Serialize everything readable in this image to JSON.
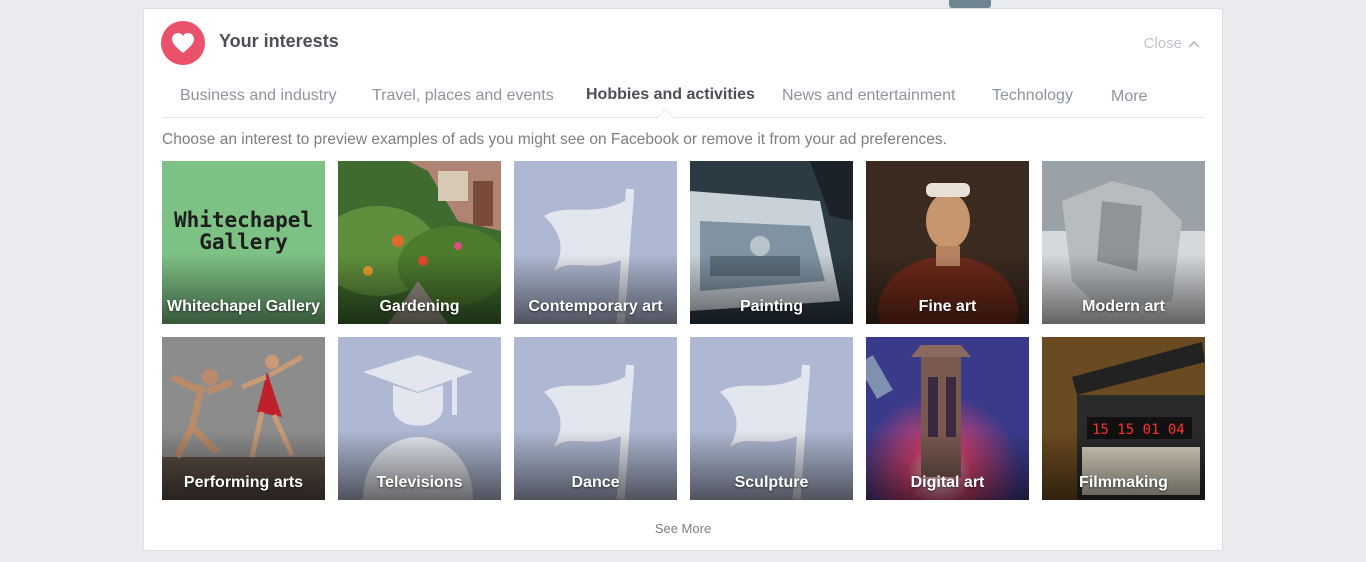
{
  "header": {
    "title": "Your interests",
    "close_label": "Close",
    "heart_icon": "heart-icon",
    "accent_color": "#e9526a"
  },
  "tabs": [
    {
      "label": "Business and industry"
    },
    {
      "label": "Travel, places and events"
    },
    {
      "label": "Hobbies and activities",
      "active": true
    },
    {
      "label": "News and entertainment"
    },
    {
      "label": "Technology"
    },
    {
      "label": "More"
    }
  ],
  "description": "Choose an interest to preview examples of ads you might see on Facebook or remove it from your ad preferences.",
  "interests": [
    {
      "label": "Whitechapel Gallery",
      "logo_text_1": "Whitechapel",
      "logo_text_2": "Gallery"
    },
    {
      "label": "Gardening"
    },
    {
      "label": "Contemporary art",
      "icon": "flag-icon"
    },
    {
      "label": "Painting"
    },
    {
      "label": "Fine art"
    },
    {
      "label": "Modern art"
    },
    {
      "label": "Performing arts"
    },
    {
      "label": "Televisions",
      "icon": "graduation-cap-icon"
    },
    {
      "label": "Dance",
      "icon": "flag-icon"
    },
    {
      "label": "Sculpture",
      "icon": "flag-icon"
    },
    {
      "label": "Digital art"
    },
    {
      "label": "Filmmaking",
      "clapper_text": "15 15 01 04"
    }
  ],
  "see_more_label": "See More"
}
